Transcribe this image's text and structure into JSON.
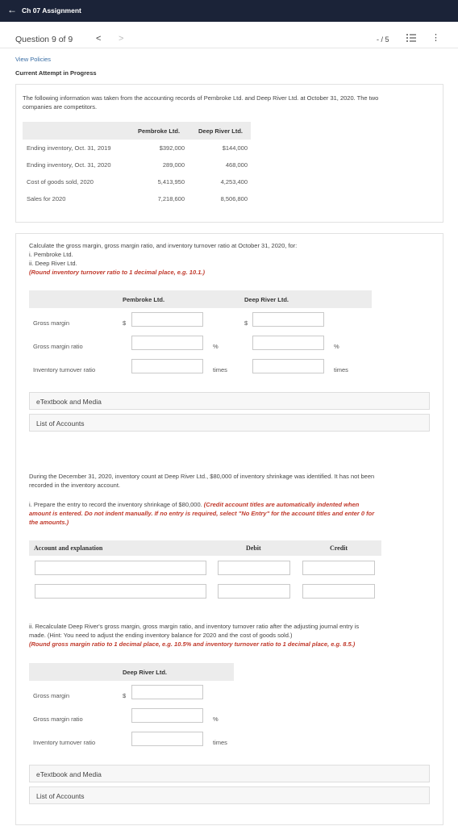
{
  "header": {
    "back_icon": "arrow-left-icon",
    "title": "Ch 07 Assignment"
  },
  "nav": {
    "question": "Question 9 of 9",
    "prev": "<",
    "next": ">",
    "score": "- / 5"
  },
  "links": {
    "view_policies": "View Policies",
    "attempt": "Current Attempt in Progress"
  },
  "intro": {
    "line1": "The following information was taken from the accounting records of Pembroke Ltd. and Deep River Ltd. at October 31, 2020. The two",
    "line2": "companies are competitors."
  },
  "data_table": {
    "headers": [
      "Pembroke Ltd.",
      "Deep River Ltd."
    ],
    "rows": [
      {
        "label": "Ending inventory, Oct. 31, 2019",
        "a": "$392,000",
        "b": "$144,000"
      },
      {
        "label": "Ending inventory, Oct. 31, 2020",
        "a": "289,000",
        "b": "468,000"
      },
      {
        "label": "Cost of goods sold, 2020",
        "a": "5,413,950",
        "b": "4,253,400"
      },
      {
        "label": "Sales for 2020",
        "a": "7,218,600",
        "b": "8,506,800"
      }
    ]
  },
  "part1": {
    "prompt": "Calculate the gross margin, gross margin ratio, and inventory turnover ratio at October 31, 2020, for:",
    "item_i": "i. Pembroke Ltd.",
    "item_ii": "ii. Deep River Ltd.",
    "note": "(Round inventory turnover ratio to 1 decimal place, e.g. 10.1.)",
    "col_a": "Pembroke Ltd.",
    "col_b": "Deep River Ltd.",
    "rows": [
      "Gross margin",
      "Gross margin ratio",
      "Inventory turnover ratio"
    ],
    "dollar": "$",
    "percent": "%",
    "times": "times"
  },
  "resources": {
    "etextbook": "eTextbook and Media",
    "accounts": "List of Accounts"
  },
  "part2": {
    "line1": "During the December 31, 2020, inventory count at Deep River Ltd., $80,000 of inventory shrinkage was identified. It has not been",
    "line2": "recorded in the inventory account.",
    "instr_plain": "i. Prepare the entry to record the inventory shrinkage of $80,000.",
    "instr_red1": " (Credit account titles are automatically indented when",
    "instr_red2": "amount is entered. Do not indent manually. If no entry is required, select \"No Entry\" for the account titles and enter 0 for",
    "instr_red3": "the amounts.)",
    "col_account": "Account and explanation",
    "col_debit": "Debit",
    "col_credit": "Credit"
  },
  "part3": {
    "line1": "ii. Recalculate Deep River's gross margin, gross margin ratio, and inventory turnover ratio after the adjusting journal entry is",
    "line2": "made. (Hint: You need to adjust the ending inventory balance for 2020 and the cost of goods sold.)",
    "note": "(Round gross margin ratio to 1 decimal place, e.g. 10.5% and inventory turnover ratio to 1 decimal place, e.g. 8.5.)",
    "col": "Deep River Ltd."
  }
}
